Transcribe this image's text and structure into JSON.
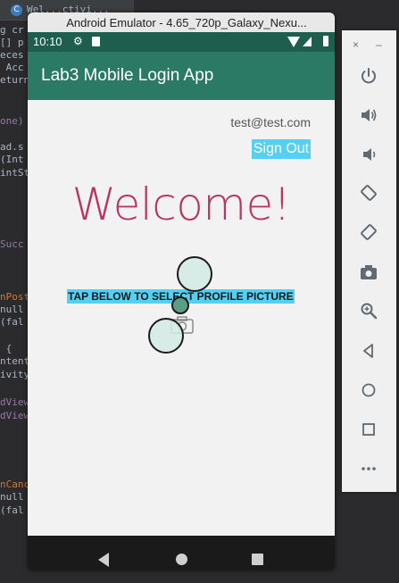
{
  "ide": {
    "tab_icon": "C",
    "tab_title": "Wel...ctivi...",
    "code_lines": [
      {
        "text": "g cr",
        "color": "#a9b7c6"
      },
      {
        "text": "[] p",
        "color": "#a9b7c6"
      },
      {
        "text": "eces",
        "color": "#a9b7c6"
      },
      {
        "text": " Acc",
        "color": "#a9b7c6"
      },
      {
        "text": "eturn",
        "color": "#a9b7c6"
      },
      {
        "text": "one)",
        "color": "#9876aa"
      },
      {
        "text": "ad.s",
        "color": "#a9b7c6"
      },
      {
        "text": "(Int",
        "color": "#a9b7c6"
      },
      {
        "text": "intSt",
        "color": "#a9b7c6"
      },
      {
        "text": "Succ",
        "color": "#9876aa"
      },
      {
        "text": "nPost",
        "color": "#cc7832"
      },
      {
        "text": "null",
        "color": "#a9b7c6"
      },
      {
        "text": "(fal",
        "color": "#a9b7c6"
      },
      {
        "text": " {",
        "color": "#a9b7c6"
      },
      {
        "text": "ntent",
        "color": "#a9b7c6"
      },
      {
        "text": "ivity",
        "color": "#a9b7c6"
      },
      {
        "text": "dView",
        "color": "#9876aa"
      },
      {
        "text": "dView",
        "color": "#9876aa"
      },
      {
        "text": "nCanc",
        "color": "#cc7832"
      },
      {
        "text": "null",
        "color": "#a9b7c6"
      },
      {
        "text": "(fal",
        "color": "#a9b7c6"
      }
    ]
  },
  "emulator": {
    "window_title": "Android Emulator - 4.65_720p_Galaxy_Nexu..."
  },
  "status_bar": {
    "time": "10:10",
    "icons": [
      "gear-icon",
      "sd-card-icon",
      "wifi-icon",
      "signal-icon",
      "battery-icon"
    ]
  },
  "app": {
    "title": "Lab3 Mobile Login App",
    "email": "test@test.com",
    "sign_out_label": "Sign Out",
    "welcome_text": "Welcome!",
    "select_picture_label": "TAP BELOW TO SELECT PROFILE PICTURE",
    "camera_icon": "camera-icon"
  },
  "nav_bar": {
    "icons": [
      "back-icon",
      "home-icon",
      "recents-icon"
    ]
  },
  "control_panel": {
    "close_label": "×",
    "minimize_label": "–",
    "buttons": [
      "power-icon",
      "volume-up-icon",
      "volume-down-icon",
      "rotate-left-icon",
      "rotate-right-icon",
      "screenshot-icon",
      "zoom-icon",
      "back-icon",
      "home-icon",
      "overview-icon",
      "more-icon"
    ]
  },
  "colors": {
    "app_bar": "#2a7a66",
    "status_bar": "#1e5e4e",
    "accent": "#55d0f2",
    "welcome": "#b83565"
  }
}
